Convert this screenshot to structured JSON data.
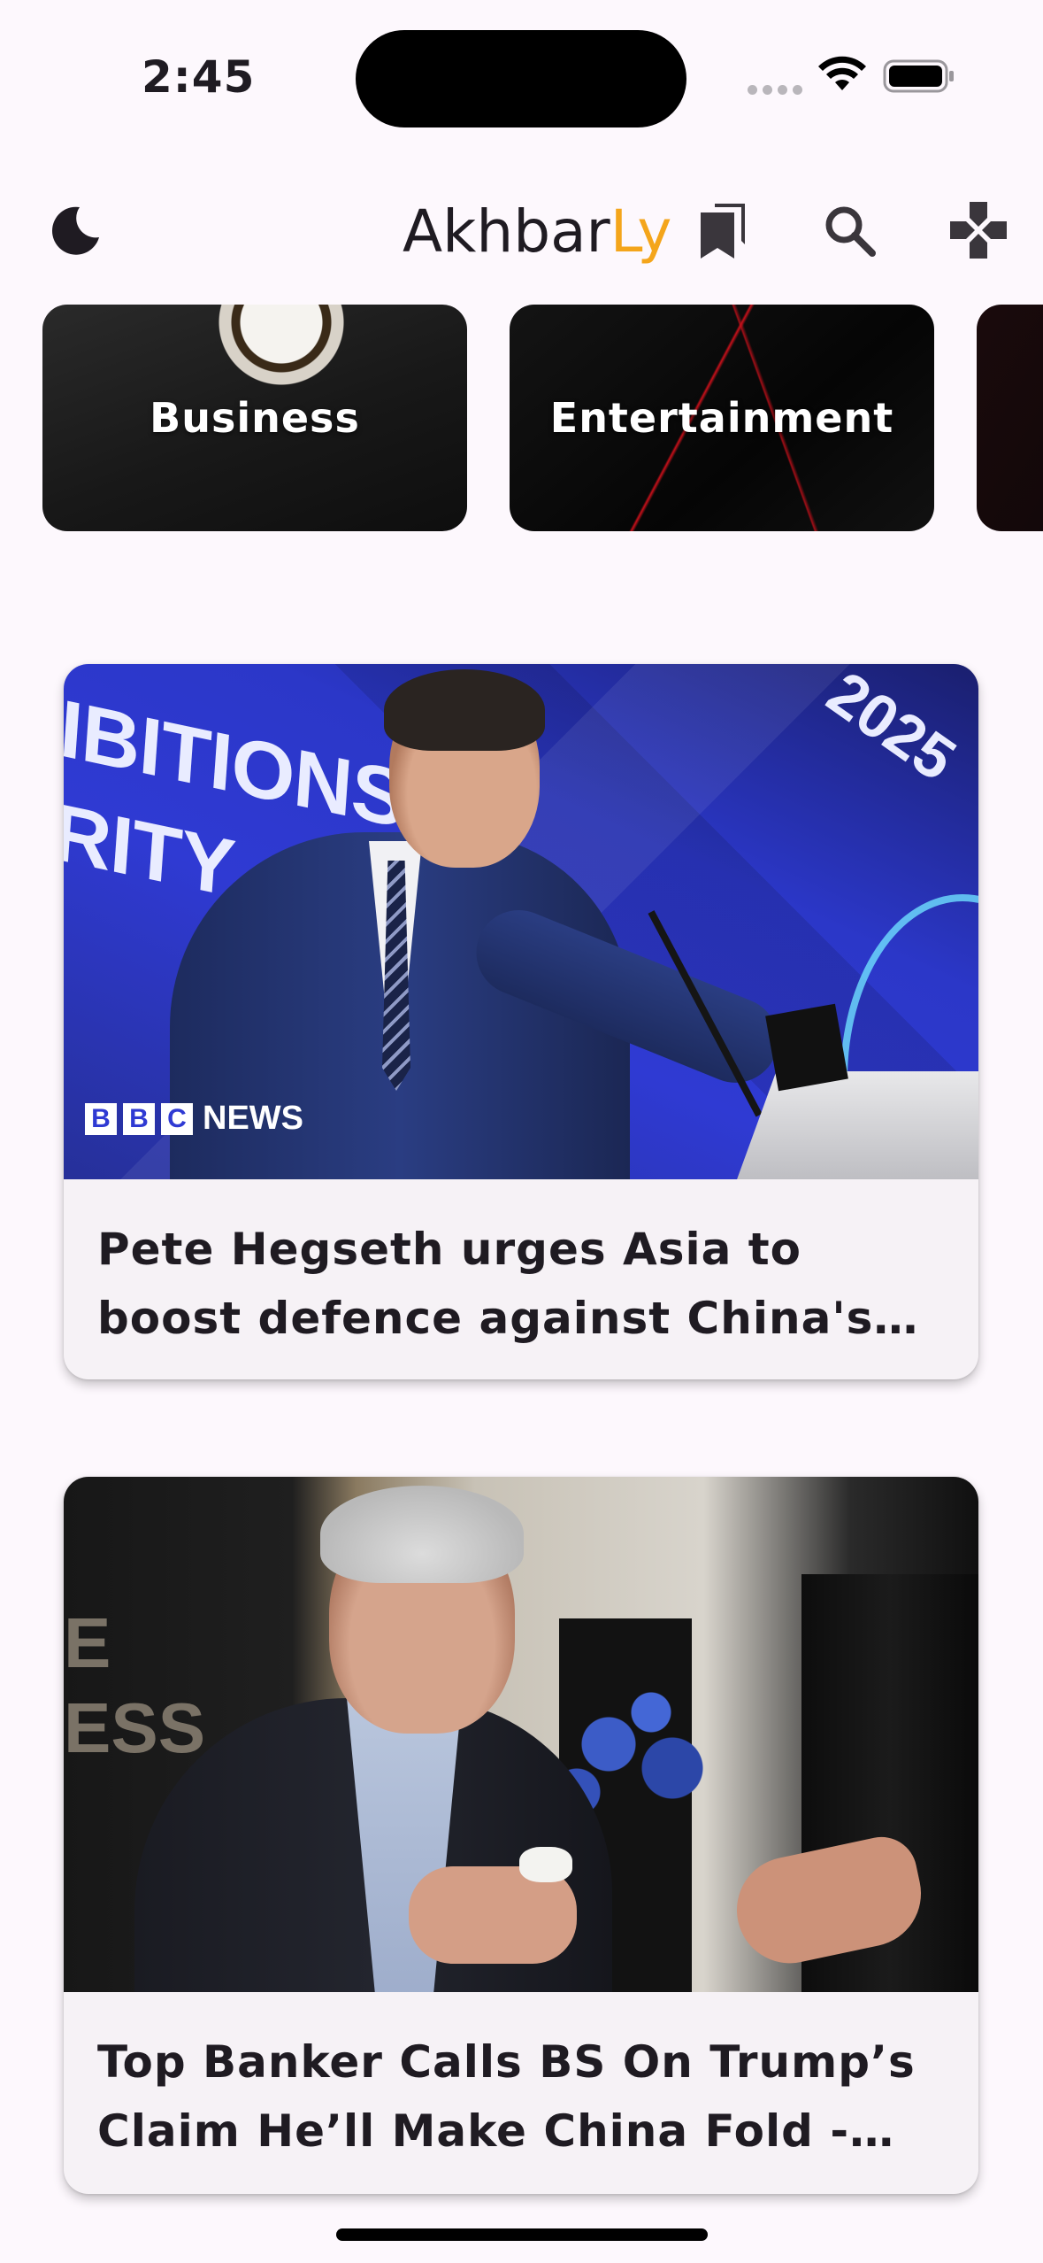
{
  "status_bar": {
    "time": "2:45"
  },
  "app_bar": {
    "title_main": "Akhbar",
    "title_accent": "Ly",
    "accent_color": "#f4a51b",
    "icons": [
      "moon-icon",
      "bookmark-icon",
      "search-icon",
      "game-controller-icon"
    ]
  },
  "categories": [
    {
      "label": "Business"
    },
    {
      "label": "Entertainment"
    },
    {
      "label": ""
    }
  ],
  "articles": [
    {
      "title": "Pete Hegseth urges Asia to boost defence against China's 'imminent' threat",
      "image_text": {
        "backdrop_line1": "IBITIONS",
        "backdrop_line2": "RITY",
        "backdrop_year": "2025",
        "source_logo": [
          "B",
          "B",
          "C"
        ],
        "source_logo_word": "NEWS"
      }
    },
    {
      "title": "Top Banker Calls BS On Trump’s Claim He’ll Make China Fold - The Daily Beast",
      "image_text": {
        "sign_line1": "E",
        "sign_line2": "ESS"
      }
    }
  ]
}
